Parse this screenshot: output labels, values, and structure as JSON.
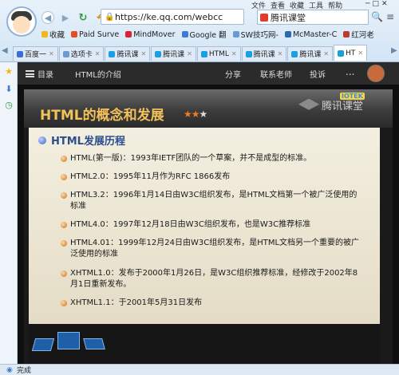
{
  "browser": {
    "menus": [
      "文件",
      "查看",
      "收藏",
      "工具",
      "帮助"
    ],
    "address": "https://ke.qq.com/webcc",
    "search_text": "腾讯课堂",
    "bookmarks": [
      "收藏",
      "Paid Surve",
      "MindMover",
      "Google 翻",
      "SW技巧网-",
      "McMaster-C",
      "红河老"
    ],
    "tabs": [
      "百度一",
      "选项卡",
      "腾讯课",
      "腾讯课",
      "HTML",
      "腾讯课",
      "腾讯课",
      "HT"
    ],
    "status": "完成",
    "colors": {
      "chrome": "#d3e5f5",
      "reload": "#2e9d3a"
    }
  },
  "course": {
    "menu_label": "目录",
    "lesson_title": "HTML的介绍",
    "share": "分享",
    "contact": "联系老师",
    "complain": "投诉",
    "more": "..."
  },
  "slide": {
    "title": "HTML的概念和发展",
    "stars": "★★★",
    "logo_text": "腾讯课堂",
    "badge": "IOTEK",
    "heading": "HTML发展历程",
    "items": [
      "HTML(第一版)：1993年IETF团队的一个草案，并不是成型的标准。",
      "HTML2.0：1995年11月作为RFC 1866发布",
      "HTML3.2：1996年1月14日由W3C组织发布，是HTML文档第一个被广泛使用的标准",
      "HTML4.0：1997年12月18日由W3C组织发布，也是W3C推荐标准",
      "HTML4.01：1999年12月24日由W3C组织发布，是HTML文档另一个重要的被广泛使用的标准",
      "XHTML1.0：发布于2000年1月26日，是W3C组织推荐标准，经修改于2002年8月1日重新发布。",
      "XHTML1.1：于2001年5月31日发布"
    ],
    "colors": {
      "title": "#f4c15a",
      "heading": "#2c4d8e",
      "body": "#f3efe0"
    }
  }
}
